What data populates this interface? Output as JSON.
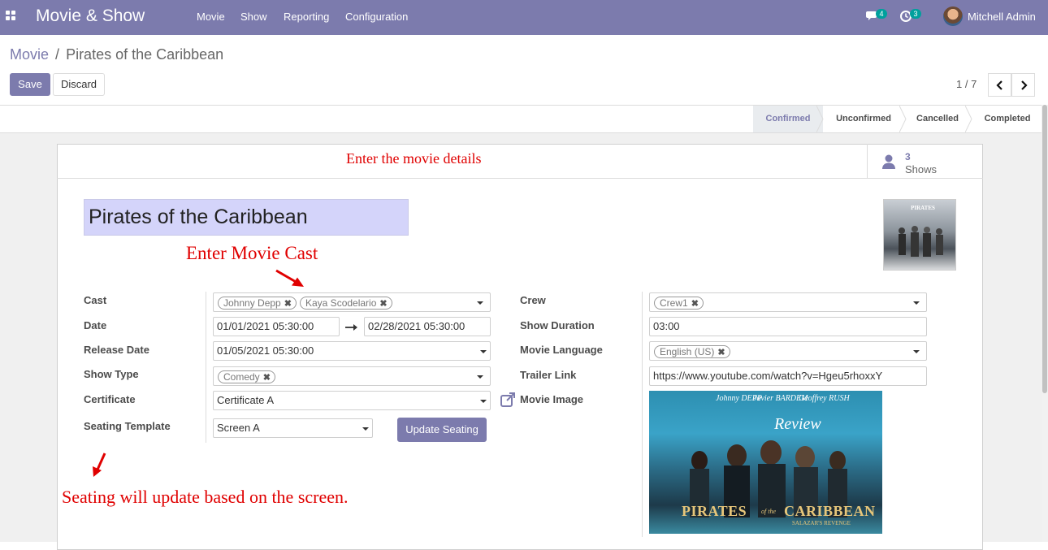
{
  "navbar": {
    "app_name": "Movie & Show",
    "menus": [
      "Movie",
      "Show",
      "Reporting",
      "Configuration"
    ],
    "messages_count": "4",
    "activities_count": "3",
    "user_name": "Mitchell Admin"
  },
  "breadcrumb": {
    "parent": "Movie",
    "separator": "/",
    "current": "Pirates of the Caribbean"
  },
  "buttons": {
    "save": "Save",
    "discard": "Discard",
    "update_seating": "Update Seating"
  },
  "pager": {
    "value": "1 / 7"
  },
  "statusbar": {
    "stages": [
      "Confirmed",
      "Unconfirmed",
      "Cancelled",
      "Completed"
    ],
    "active": "Confirmed"
  },
  "smart_button": {
    "count": "3",
    "label": "Shows"
  },
  "annotations": {
    "header": "Enter the movie details",
    "cast": "Enter Movie Cast",
    "seating": "Seating will update based on the screen."
  },
  "movie": {
    "name": "Pirates of the Caribbean"
  },
  "labels": {
    "cast": "Cast",
    "date": "Date",
    "release_date": "Release Date",
    "show_type": "Show Type",
    "certificate": "Certificate",
    "seating_template": "Seating Template",
    "crew": "Crew",
    "show_duration": "Show Duration",
    "movie_language": "Movie Language",
    "trailer_link": "Trailer Link",
    "movie_image": "Movie Image"
  },
  "values": {
    "cast_tags": [
      "Johnny Depp",
      "Kaya Scodelario"
    ],
    "date_start": "01/01/2021 05:30:00",
    "date_end": "02/28/2021 05:30:00",
    "release_date": "01/05/2021 05:30:00",
    "show_type_tags": [
      "Comedy"
    ],
    "certificate": "Certificate A",
    "seating_template": "Screen A",
    "crew_tags": [
      "Crew1"
    ],
    "show_duration": "03:00",
    "movie_language_tags": [
      "English (US)"
    ],
    "trailer_link": "https://www.youtube.com/watch?v=Hgeu5rhoxxY"
  },
  "poster_text": {
    "names": [
      "Johnny DEPP",
      "Javier BARDEM",
      "Geoffrey RUSH"
    ],
    "review": "Review",
    "title_left": "PIRATES",
    "title_mid": "of the",
    "title_right": "CARIBBEAN",
    "subtitle": "SALAZAR'S REVENGE"
  },
  "colors": {
    "primary": "#7c7bad",
    "annotation_red": "#e00000",
    "title_bg": "#d4d4fa"
  }
}
